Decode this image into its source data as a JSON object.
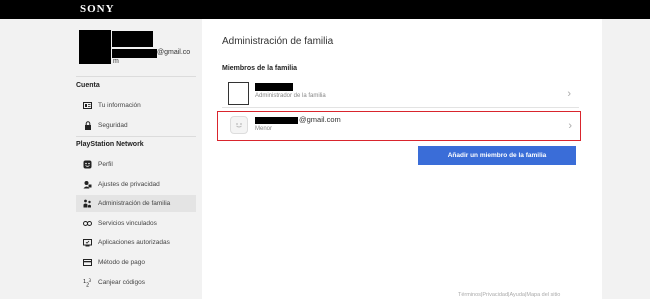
{
  "brand": {
    "logo": "SONY"
  },
  "profile": {
    "email_domain": "@gmail.co",
    "email_wrap": "m"
  },
  "sidebar": {
    "section_account": "Cuenta",
    "section_psn": "PlayStation Network",
    "items": [
      {
        "label": "Tu información",
        "icon": "id-card-icon"
      },
      {
        "label": "Seguridad",
        "icon": "lock-icon"
      },
      {
        "label": "Perfil",
        "icon": "smiley-icon"
      },
      {
        "label": "Ajustes de privacidad",
        "icon": "privacy-icon"
      },
      {
        "label": "Administración de familia",
        "icon": "family-icon"
      },
      {
        "label": "Servicios vinculados",
        "icon": "link-icon"
      },
      {
        "label": "Aplicaciones autorizadas",
        "icon": "apps-icon"
      },
      {
        "label": "Método de pago",
        "icon": "card-icon"
      },
      {
        "label": "Canjear códigos",
        "icon": "code-icon"
      }
    ]
  },
  "main": {
    "title": "Administración de familia",
    "members_heading": "Miembros de la familia",
    "members": [
      {
        "subtitle": "Administrador de la familia"
      },
      {
        "email_domain": "@gmail.com",
        "subtitle": "Menor"
      }
    ],
    "add_button": "Añadir un miembro de la familia"
  },
  "footer": {
    "links": "Términos|Privacidad|Ayuda|Mapa del sitio"
  },
  "colors": {
    "accent": "#3a6dd8",
    "highlight": "#d9252d",
    "topbar": "#000000"
  }
}
